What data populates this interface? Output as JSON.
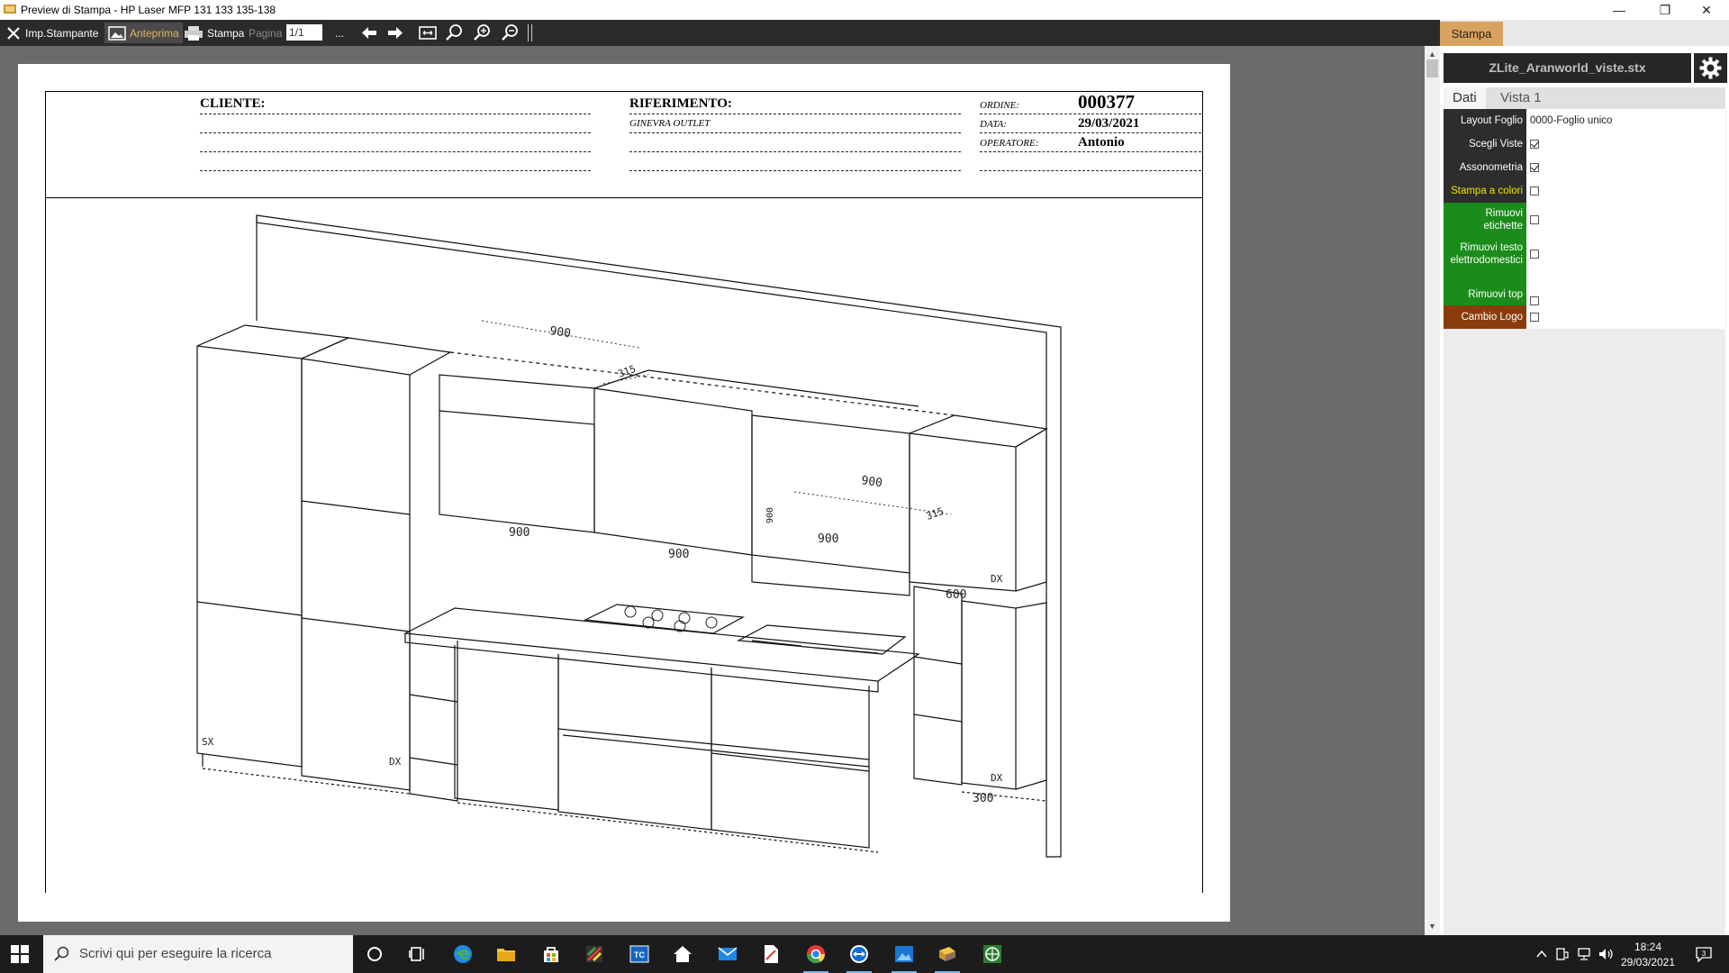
{
  "window": {
    "title": "Preview di Stampa - HP Laser MFP 131 133 135-138",
    "controls": [
      "minimize",
      "restore",
      "close"
    ]
  },
  "toolbar": {
    "printer_settings": "Imp.Stampante",
    "preview": "Anteprima",
    "print": "Stampa",
    "page_label": "Pagina",
    "page_value": "1/1",
    "more": "...",
    "icons": [
      "arrow-left-icon",
      "arrow-right-icon",
      "fit-page-icon",
      "zoom-icon",
      "zoom-in-icon",
      "zoom-out-icon"
    ]
  },
  "sheet": {
    "cliente_label": "CLIENTE:",
    "riferimento_label": "RIFERIMENTO:",
    "riferimento_value": "GINEVRA OUTLET",
    "ordine_label": "ORDINE:",
    "ordine_value": "000377",
    "data_label": "DATA:",
    "data_value": "29/03/2021",
    "operatore_label": "OPERATORE:",
    "operatore_value": "Antonio"
  },
  "drawing": {
    "dimensions": [
      "900",
      "315",
      "900",
      "900",
      "900",
      "315",
      "600",
      "300",
      "900",
      "900"
    ],
    "side_labels": [
      "SX",
      "DX",
      "DX",
      "DX"
    ]
  },
  "panel": {
    "tab": "Stampa",
    "file_name": "ZLite_Aranworld_viste.stx",
    "subtabs": [
      "Dati",
      "Vista 1"
    ],
    "rows": [
      {
        "label": "Layout Foglio",
        "value": "0000-Foglio unico",
        "type": "text"
      },
      {
        "label": "Scegli Viste",
        "checked": true,
        "type": "check"
      },
      {
        "label": "Assonometria",
        "checked": true,
        "type": "check"
      },
      {
        "label": "Stampa a colori",
        "checked": false,
        "type": "check"
      },
      {
        "label": "Rimuovi etichette",
        "checked": false,
        "type": "check"
      },
      {
        "label": "Rimuovi testo elettrodomestici",
        "checked": false,
        "type": "check"
      },
      {
        "label": "Rimuovi top",
        "checked": false,
        "type": "check"
      },
      {
        "label": "Cambio Logo",
        "checked": false,
        "type": "check"
      }
    ],
    "colors": {
      "tab": "#d9a35f",
      "green": "#1b8c1b",
      "brown": "#8a3c0c",
      "yellow_text": "#f2e200"
    }
  },
  "taskbar": {
    "search_placeholder": "Scrivi qui per eseguire la ricerca",
    "time": "18:24",
    "date": "29/03/2021"
  }
}
